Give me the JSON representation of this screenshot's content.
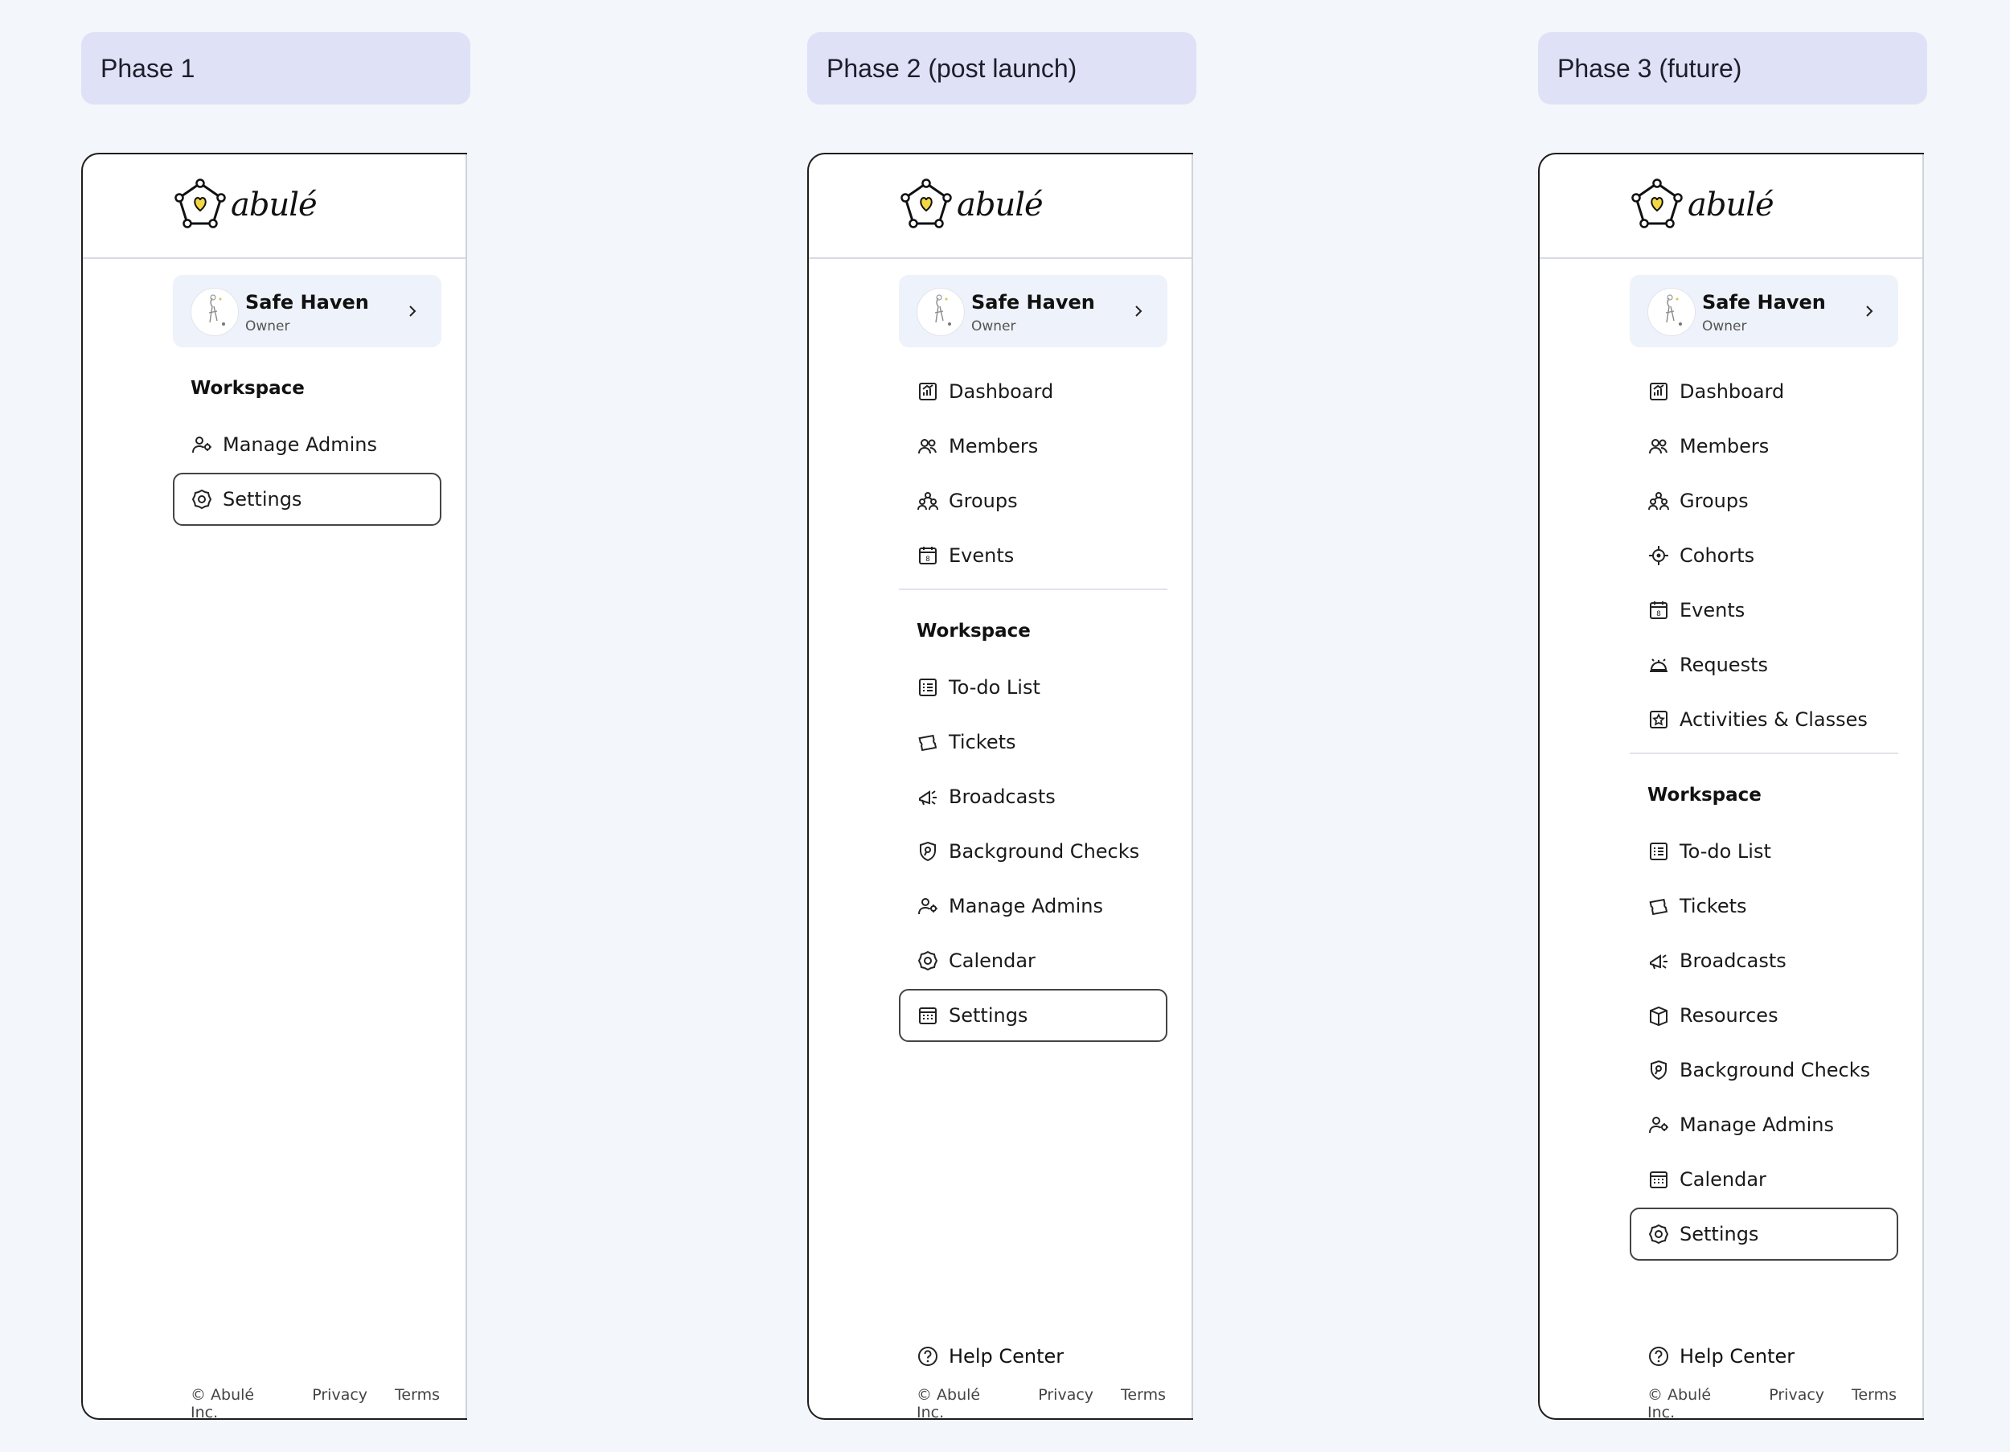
{
  "phases": [
    {
      "label": "Phase 1",
      "brand": "abulé",
      "profile": {
        "name": "Safe Haven",
        "role": "Owner"
      },
      "top_items": [],
      "section_title": "Workspace",
      "workspace_items": [
        {
          "label": "Manage Admins",
          "icon": "manage-admins-icon"
        },
        {
          "label": "Settings",
          "icon": "settings-icon",
          "selected": true
        }
      ],
      "help": null,
      "footer": [
        "© Abulé Inc.",
        "Privacy",
        "Terms"
      ]
    },
    {
      "label": "Phase 2 (post launch)",
      "brand": "abulé",
      "profile": {
        "name": "Safe Haven",
        "role": "Owner"
      },
      "top_items": [
        {
          "label": "Dashboard",
          "icon": "dashboard-icon"
        },
        {
          "label": "Members",
          "icon": "members-icon"
        },
        {
          "label": "Groups",
          "icon": "groups-icon"
        },
        {
          "label": "Events",
          "icon": "events-icon"
        }
      ],
      "section_title": "Workspace",
      "workspace_items": [
        {
          "label": "To-do List",
          "icon": "todo-list-icon"
        },
        {
          "label": "Tickets",
          "icon": "tickets-icon"
        },
        {
          "label": "Broadcasts",
          "icon": "broadcasts-icon"
        },
        {
          "label": "Background Checks",
          "icon": "background-checks-icon"
        },
        {
          "label": "Manage Admins",
          "icon": "manage-admins-icon"
        },
        {
          "label": "Calendar",
          "icon": "settings-icon"
        },
        {
          "label": "Settings",
          "icon": "calendar-icon",
          "selected": true
        }
      ],
      "help": "Help Center",
      "footer": [
        "© Abulé Inc.",
        "Privacy",
        "Terms"
      ]
    },
    {
      "label": "Phase 3 (future)",
      "brand": "abulé",
      "profile": {
        "name": "Safe Haven",
        "role": "Owner"
      },
      "top_items": [
        {
          "label": "Dashboard",
          "icon": "dashboard-icon"
        },
        {
          "label": "Members",
          "icon": "members-icon"
        },
        {
          "label": "Groups",
          "icon": "groups-icon"
        },
        {
          "label": "Cohorts",
          "icon": "cohorts-icon"
        },
        {
          "label": "Events",
          "icon": "events-icon"
        },
        {
          "label": "Requests",
          "icon": "requests-icon"
        },
        {
          "label": "Activities & Classes",
          "icon": "activities-icon"
        }
      ],
      "section_title": "Workspace",
      "workspace_items": [
        {
          "label": "To-do List",
          "icon": "todo-list-icon"
        },
        {
          "label": "Tickets",
          "icon": "tickets-icon"
        },
        {
          "label": "Broadcasts",
          "icon": "broadcasts-icon"
        },
        {
          "label": "Resources",
          "icon": "resources-icon"
        },
        {
          "label": "Background Checks",
          "icon": "background-checks-icon"
        },
        {
          "label": "Manage Admins",
          "icon": "manage-admins-icon"
        },
        {
          "label": "Calendar",
          "icon": "calendar-icon"
        },
        {
          "label": "Settings",
          "icon": "settings-icon",
          "selected": true
        }
      ],
      "help": "Help Center",
      "footer": [
        "© Abulé Inc.",
        "Privacy",
        "Terms"
      ]
    }
  ]
}
